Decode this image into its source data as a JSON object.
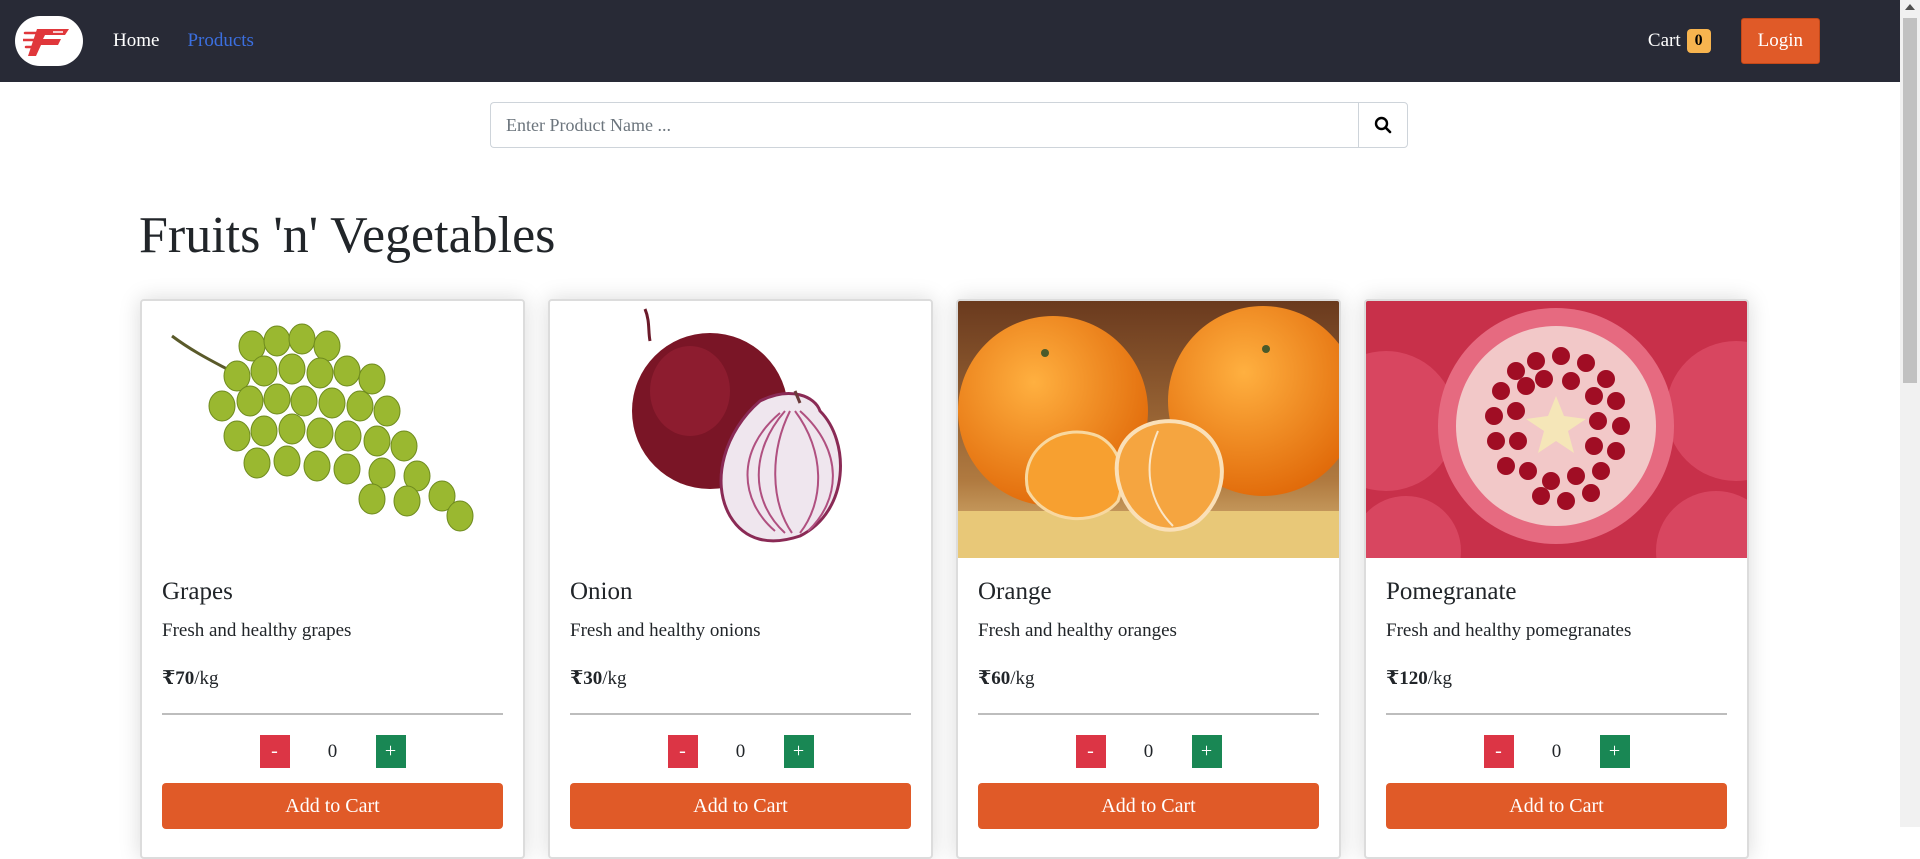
{
  "nav": {
    "home": "Home",
    "products": "Products",
    "cart_label": "Cart",
    "cart_count": "0",
    "login": "Login",
    "accent": "#e05a28",
    "bg": "#282a36"
  },
  "search": {
    "placeholder": "Enter Product Name ...",
    "icon": "search-icon"
  },
  "section": {
    "title": "Fruits 'n' Vegetables"
  },
  "products": [
    {
      "name": "Grapes",
      "desc": "Fresh and healthy grapes",
      "price": "₹70",
      "unit": "/kg",
      "qty": "0",
      "minus": "-",
      "plus": "+",
      "add": "Add to Cart"
    },
    {
      "name": "Onion",
      "desc": "Fresh and healthy onions",
      "price": "₹30",
      "unit": "/kg",
      "qty": "0",
      "minus": "-",
      "plus": "+",
      "add": "Add to Cart"
    },
    {
      "name": "Orange",
      "desc": "Fresh and healthy oranges",
      "price": "₹60",
      "unit": "/kg",
      "qty": "0",
      "minus": "-",
      "plus": "+",
      "add": "Add to Cart"
    },
    {
      "name": "Pomegranate",
      "desc": "Fresh and healthy pomegranates",
      "price": "₹120",
      "unit": "/kg",
      "qty": "0",
      "minus": "-",
      "plus": "+",
      "add": "Add to Cart"
    }
  ]
}
